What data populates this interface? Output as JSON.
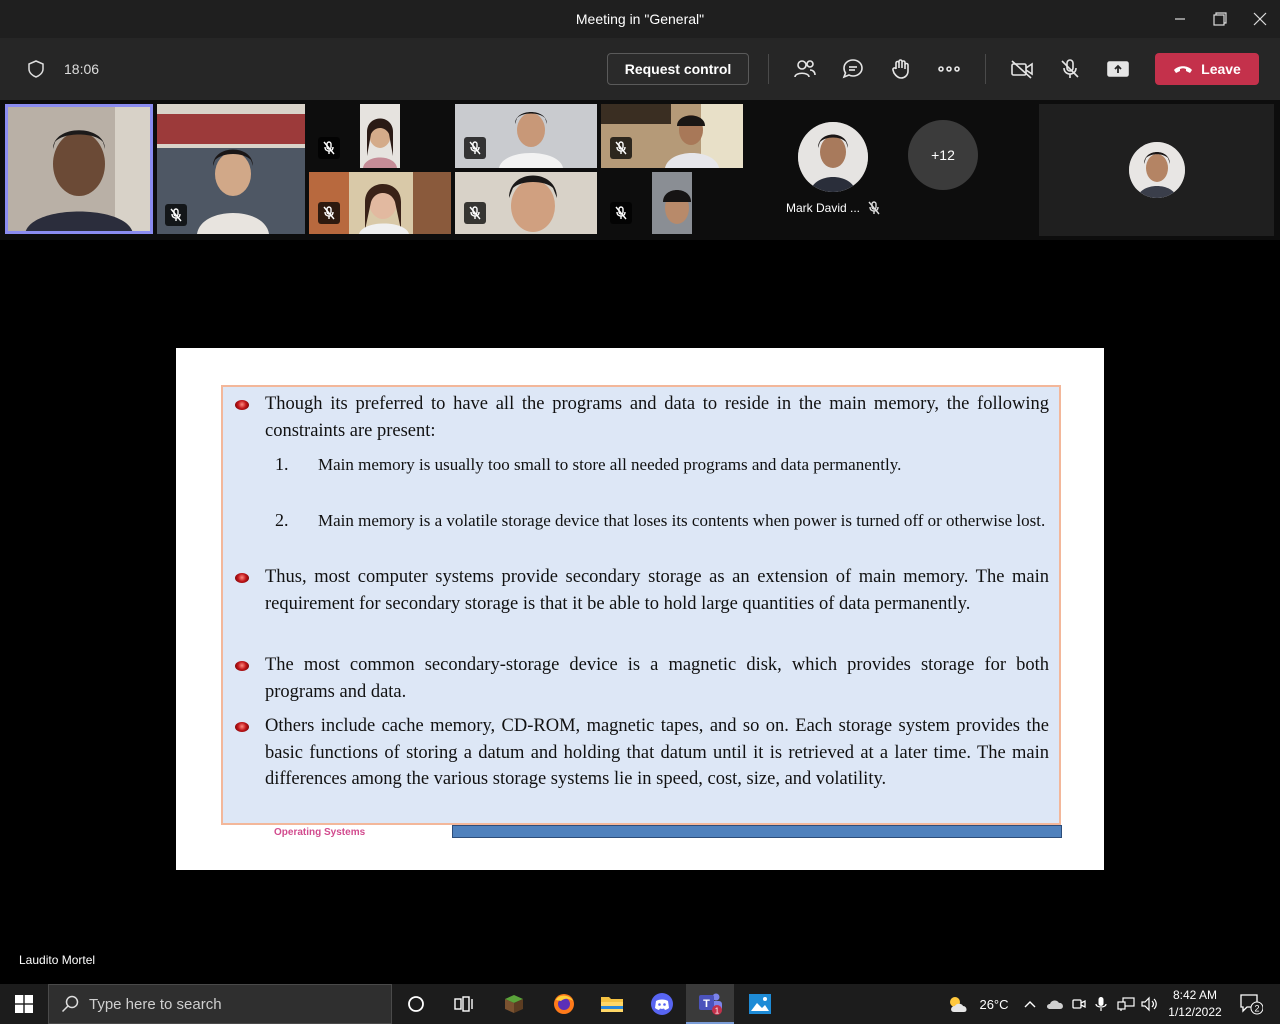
{
  "window": {
    "title": "Meeting in \"General\""
  },
  "meeting": {
    "timer": "18:06",
    "request_control": "Request control",
    "leave_label": "Leave"
  },
  "participants": {
    "overflow_count": "+12",
    "named_participant": "Mark David ..."
  },
  "slide": {
    "bullets": [
      "Though its preferred to have all the programs and data to reside in the main memory, the following constraints are present:",
      "Thus, most computer systems provide secondary storage as an extension of main memory. The main requirement for secondary storage is that it be able to hold large quantities of data permanently.",
      "The most common secondary-storage device is a magnetic disk, which provides storage for both programs and data.",
      "Others include cache memory, CD-ROM, magnetic tapes, and so on. Each storage system provides the basic functions of storing a datum and holding that datum until it is retrieved at a later time. The main differences among the various storage systems lie in speed, cost, size, and volatility."
    ],
    "sub_items": [
      {
        "num": "1.",
        "text": "Main memory is usually too small to store all needed programs and data permanently."
      },
      {
        "num": "2.",
        "text": "Main memory is a volatile storage device that loses its contents when power is turned off or otherwise lost."
      }
    ],
    "footer": "Operating Systems"
  },
  "presenter_name": "Laudito Mortel",
  "taskbar": {
    "search_placeholder": "Type here to search",
    "teams_badge": "1",
    "temperature": "26°C",
    "time": "8:42 AM",
    "date": "1/12/2022",
    "notification_count": "2"
  }
}
